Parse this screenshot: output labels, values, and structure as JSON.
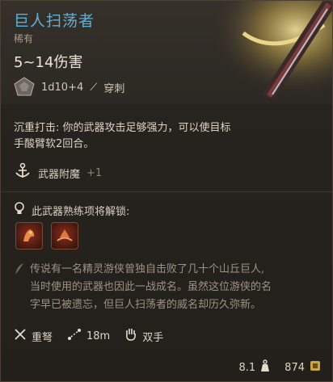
{
  "item": {
    "title": "巨人扫荡者",
    "rarity": "稀有",
    "damage": "5~14伤害",
    "dice": "1d10+4",
    "damage_type": "穿刺"
  },
  "passive": {
    "line1": "沉重打击: 你的武器攻击足够强力，可以使目标",
    "line2": "手酸臂软2回合。"
  },
  "enchant": {
    "label": "武器附魔",
    "value": "+1"
  },
  "mastery": {
    "label": "此武器熟练项将解锁:"
  },
  "lore": {
    "line1": "传说有一名精灵游侠曾独自击败了几十个山丘巨人,",
    "line2": "当时使用的武器也因此一战成名。虽然这位游侠的名",
    "line3": "字早已被遗忘，但巨人扫荡者的威名却历久弥新。"
  },
  "properties": {
    "type": "重弩",
    "range": "18m",
    "hands": "双手"
  },
  "footer": {
    "weight": "8.1",
    "price": "874"
  },
  "colors": {
    "title": "#5fb0d8",
    "accent_gold": "#c9a24a"
  }
}
